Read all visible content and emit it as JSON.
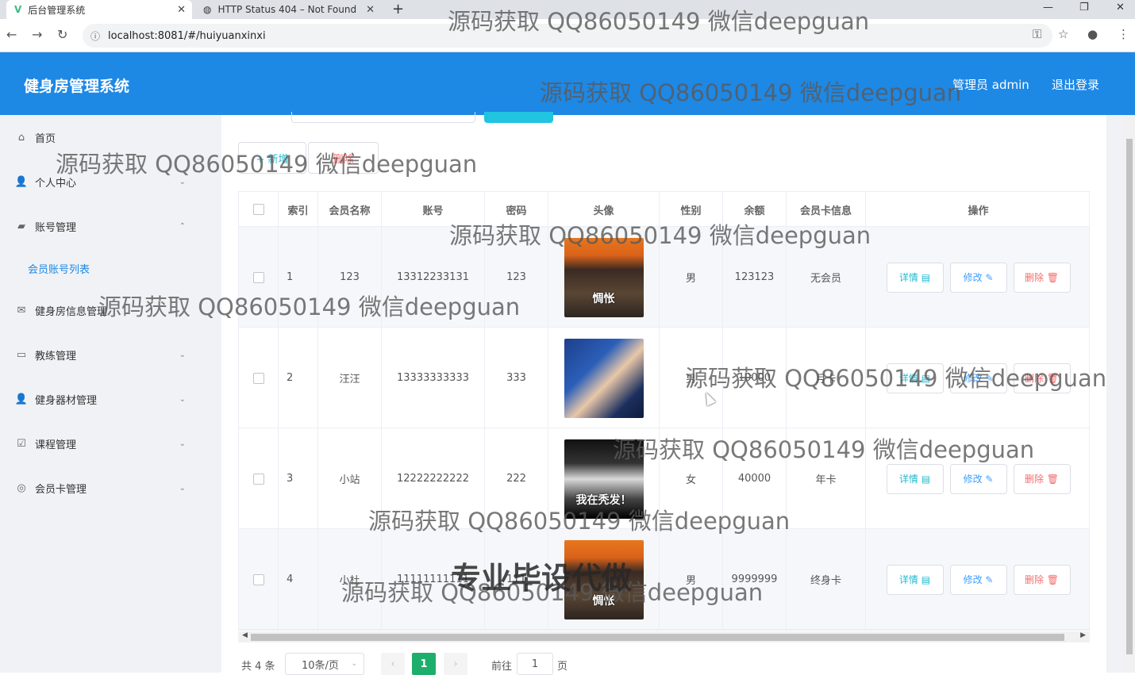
{
  "browser": {
    "tabs": [
      {
        "title": "后台管理系统",
        "active": true
      },
      {
        "title": "HTTP Status 404 – Not Found",
        "active": false
      }
    ],
    "new_tab": "+",
    "url": "localhost:8081/#/huiyuanxinxi"
  },
  "header": {
    "title": "健身房管理系统",
    "user": "管理员 admin",
    "logout": "退出登录"
  },
  "sidebar": {
    "items": [
      {
        "label": "首页",
        "icon": "home-icon",
        "arrow": ""
      },
      {
        "label": "个人中心",
        "icon": "user-icon",
        "arrow": "⌄"
      },
      {
        "label": "账号管理",
        "icon": "account-icon",
        "arrow": "⌃"
      },
      {
        "label": "健身房信息管理",
        "icon": "mail-icon",
        "arrow": "⌄"
      },
      {
        "label": "教练管理",
        "icon": "briefcase-icon",
        "arrow": "⌄"
      },
      {
        "label": "健身器材管理",
        "icon": "user-icon",
        "arrow": "⌄"
      },
      {
        "label": "课程管理",
        "icon": "checklist-icon",
        "arrow": "⌄"
      },
      {
        "label": "会员卡管理",
        "icon": "compass-icon",
        "arrow": "⌄"
      }
    ],
    "submenu": {
      "label": "会员账号列表"
    }
  },
  "toolbar": {
    "add_label": "+ 新增",
    "batch_delete_label": "删除"
  },
  "table": {
    "headers": [
      "",
      "索引",
      "会员名称",
      "账号",
      "密码",
      "头像",
      "性别",
      "余额",
      "会员卡信息",
      "操作"
    ],
    "rows": [
      {
        "index": "1",
        "name": "123",
        "account": "13312233131",
        "password": "123",
        "avatar_caption": "惆怅",
        "gender": "男",
        "balance": "123123",
        "card": "无会员"
      },
      {
        "index": "2",
        "name": "汪汪",
        "account": "13333333333",
        "password": "333",
        "avatar_caption": "",
        "gender": "男",
        "balance": "10000",
        "card": "月卡"
      },
      {
        "index": "3",
        "name": "小站",
        "account": "12222222222",
        "password": "222",
        "avatar_caption": "我在秃发！",
        "gender": "女",
        "balance": "40000",
        "card": "年卡"
      },
      {
        "index": "4",
        "name": "小杜",
        "account": "11111111111",
        "password": "111",
        "avatar_caption": "惆怅",
        "gender": "男",
        "balance": "9999999",
        "card": "终身卡"
      }
    ],
    "actions": {
      "detail": "详情 ▤",
      "edit": "修改 ✎",
      "delete": "删除 🗑"
    }
  },
  "pagination": {
    "total": "共 4 条",
    "page_size": "10条/页",
    "prev": "‹",
    "current": "1",
    "next": "›",
    "goto_prefix": "前往",
    "goto_value": "1",
    "goto_suffix": "页"
  },
  "watermarks": [
    "源码获取 QQ86050149 微信deepguan",
    "专业毕设代做"
  ]
}
